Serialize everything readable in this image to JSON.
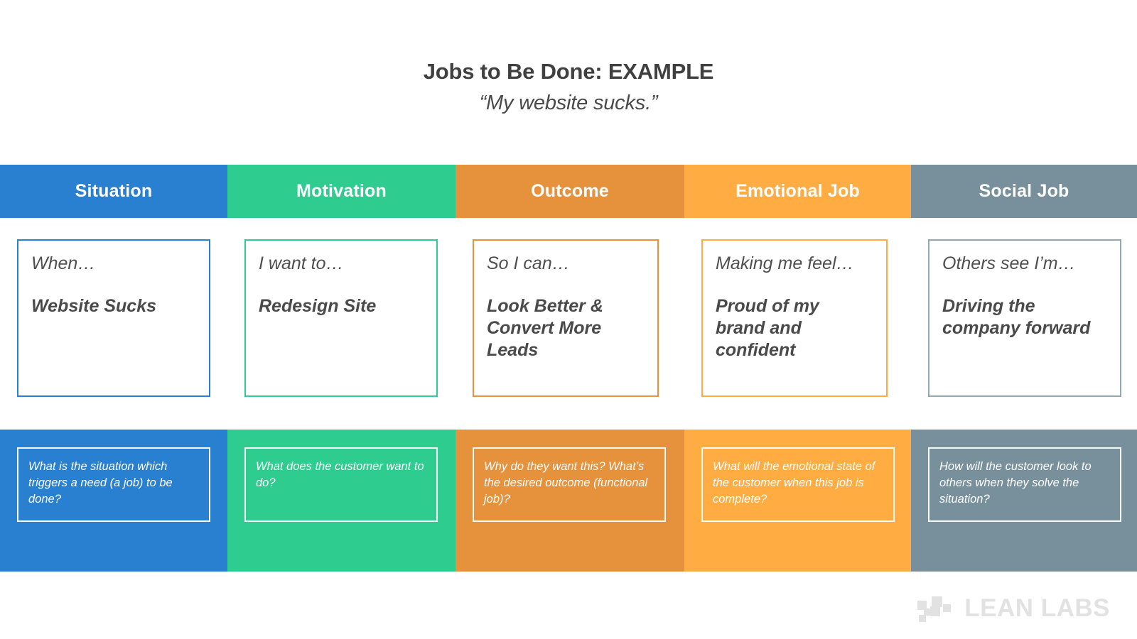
{
  "title": {
    "main_prefix": "Jobs to Be Done: ",
    "main_accent": "EXAMPLE",
    "subtitle": "“My website sucks.”"
  },
  "colors": {
    "situation": "#2980d0",
    "motivation": "#2ecc8f",
    "outcome": "#e6913c",
    "emotional": "#ffad42",
    "social": "#78909c",
    "title_text": "#404040",
    "body_text": "#4a4a4a",
    "logo": "#e2e2e2"
  },
  "columns": [
    {
      "key": "situation",
      "header": "Situation",
      "color": "#2980d0",
      "card": {
        "prompt": "When…",
        "answer": "Website Sucks"
      },
      "description": "What is the situation which triggers a need (a job) to be done?"
    },
    {
      "key": "motivation",
      "header": "Motivation",
      "color": "#2ecc8f",
      "card": {
        "prompt": "I want to…",
        "answer": "Redesign Site"
      },
      "description": "What does the customer want to do?"
    },
    {
      "key": "outcome",
      "header": "Outcome",
      "color": "#e6913c",
      "card": {
        "prompt": "So I can…",
        "answer": "Look Better & Convert More Leads"
      },
      "description": "Why do they want this? What’s the desired outcome (functional job)?"
    },
    {
      "key": "emotional",
      "header": "Emotional Job",
      "color": "#ffad42",
      "card": {
        "prompt": "Making me feel…",
        "answer": "Proud of my brand and confident"
      },
      "description": "What will the emotional state of the customer when this job is complete?"
    },
    {
      "key": "social",
      "header": "Social Job",
      "color": "#78909c",
      "card": {
        "prompt": "Others see I’m…",
        "answer": "Driving the company forward"
      },
      "description": "How will the customer look to others when they solve the situation?"
    }
  ],
  "logo": {
    "text": "LEAN LABS",
    "mark": "node-cluster-icon"
  }
}
